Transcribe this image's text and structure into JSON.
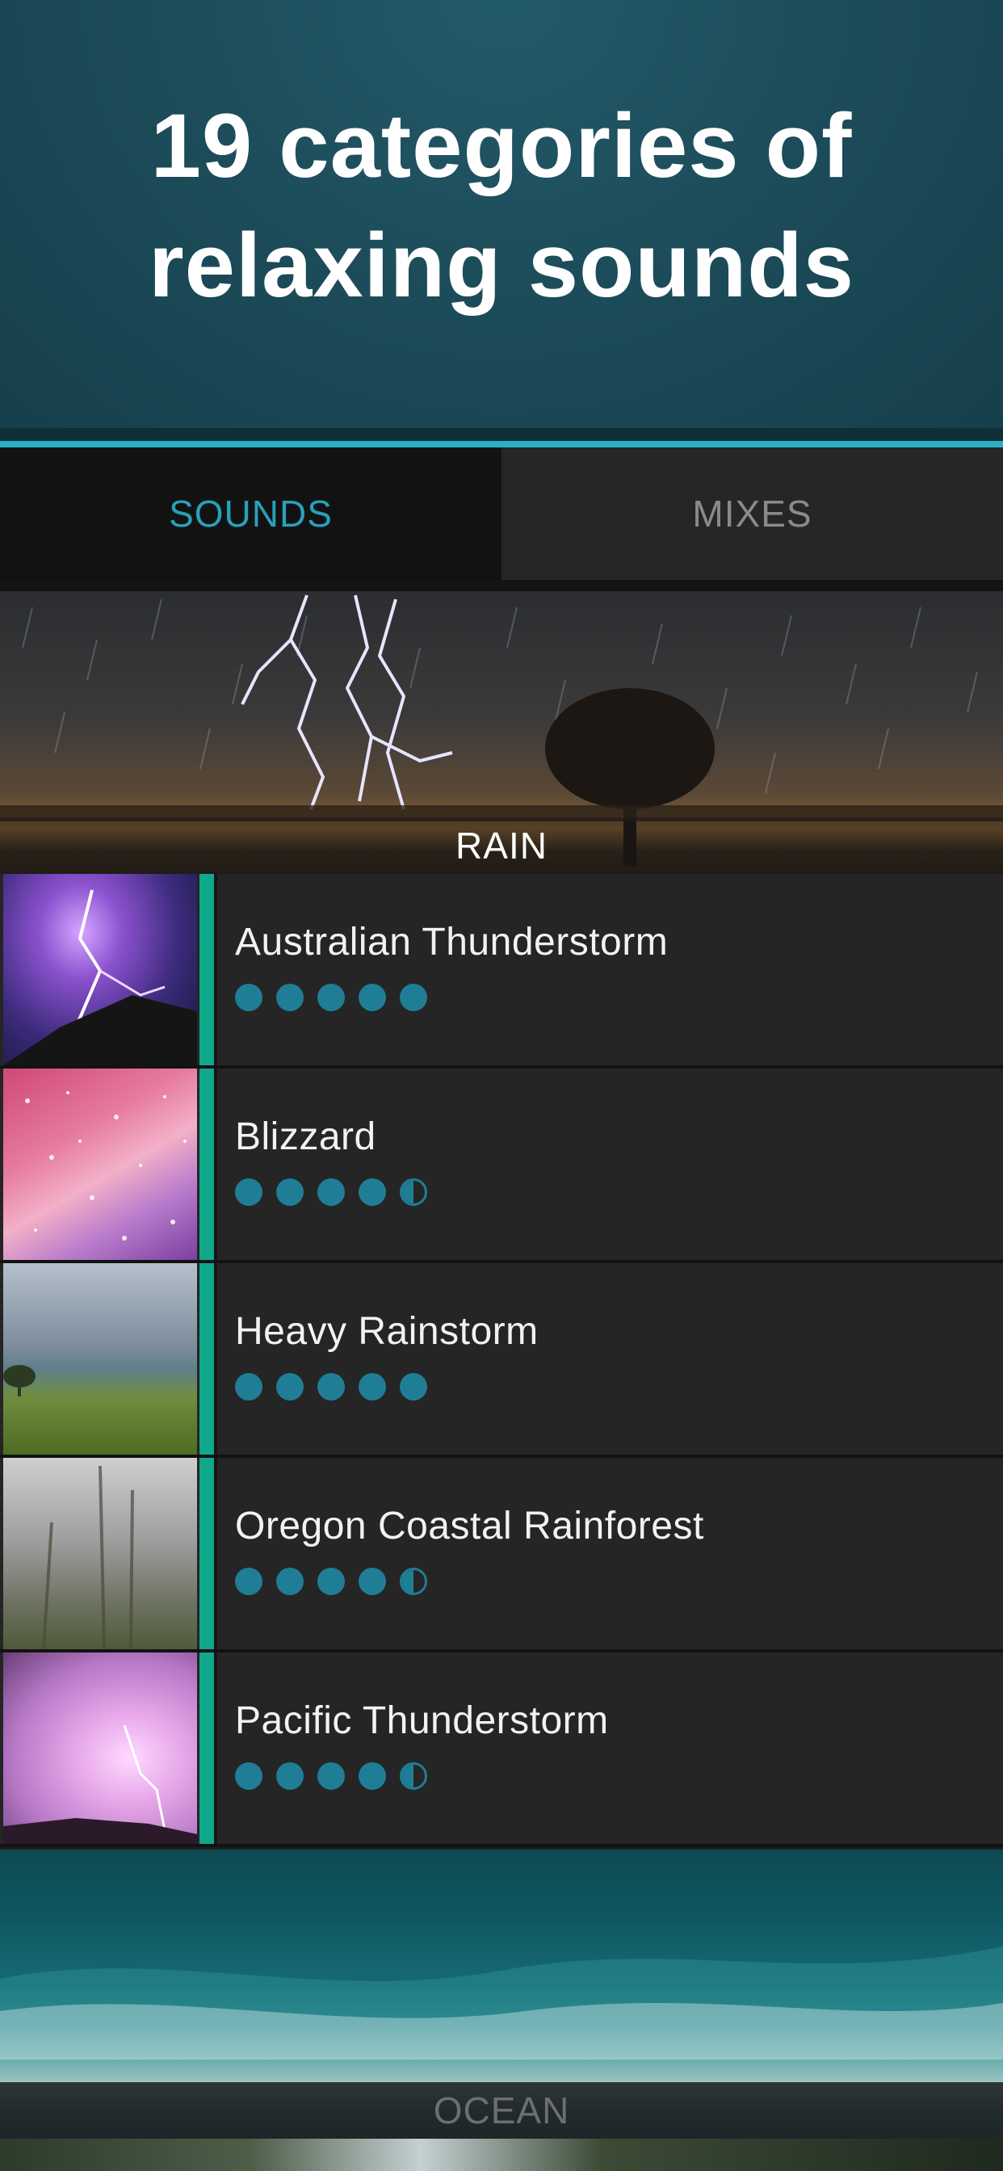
{
  "promo": {
    "title_line1": "19 categories of",
    "title_line2": "relaxing sounds"
  },
  "tabs": [
    {
      "label": "SOUNDS",
      "active": true
    },
    {
      "label": "MIXES",
      "active": false
    }
  ],
  "categories": [
    {
      "label": "RAIN"
    },
    {
      "label": "OCEAN"
    }
  ],
  "sounds": [
    {
      "title": "Australian Thunderstorm",
      "rating": 5
    },
    {
      "title": "Blizzard",
      "rating": 4.5
    },
    {
      "title": "Heavy Rainstorm",
      "rating": 5
    },
    {
      "title": "Oregon Coastal Rainforest",
      "rating": 4.5
    },
    {
      "title": "Pacific Thunderstorm",
      "rating": 4.5
    }
  ],
  "colors": {
    "accent": "#2bb0c3",
    "active_tab_text": "#27a1bb",
    "rating_dot": "#1f7e95",
    "selected_bar": "#0fa88a"
  }
}
